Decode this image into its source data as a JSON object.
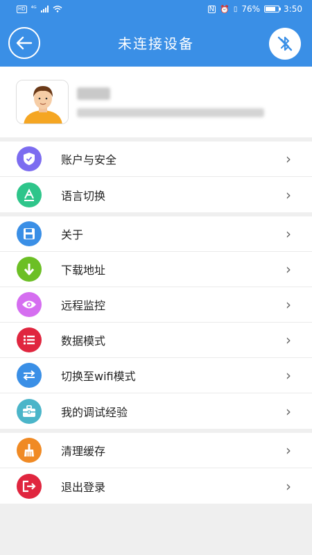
{
  "status": {
    "network": "⁴ᴳ",
    "battery": "76%",
    "time": "3:50"
  },
  "header": {
    "title": "未连接设备"
  },
  "menu_groups": [
    [
      {
        "label": "账户与安全",
        "icon": "shield-icon",
        "color": "#7c6cf0"
      },
      {
        "label": "语言切换",
        "icon": "letter-a-icon",
        "color": "#2ec58a"
      }
    ],
    [
      {
        "label": "关于",
        "icon": "floppy-disk-icon",
        "color": "#3a8fe6"
      },
      {
        "label": "下载地址",
        "icon": "download-arrow-icon",
        "color": "#6cbf25"
      },
      {
        "label": "远程监控",
        "icon": "eye-icon",
        "color": "#d56ef0"
      },
      {
        "label": "数据模式",
        "icon": "list-icon",
        "color": "#e0263f"
      },
      {
        "label": "切换至wifi模式",
        "icon": "swap-arrows-icon",
        "color": "#3a8fe6"
      },
      {
        "label": "我的调试经验",
        "icon": "toolbox-icon",
        "color": "#4bb5c9"
      }
    ],
    [
      {
        "label": "清理缓存",
        "icon": "broom-icon",
        "color": "#f08a24"
      },
      {
        "label": "退出登录",
        "icon": "logout-icon",
        "color": "#e0263f"
      }
    ]
  ],
  "chevron": "›"
}
